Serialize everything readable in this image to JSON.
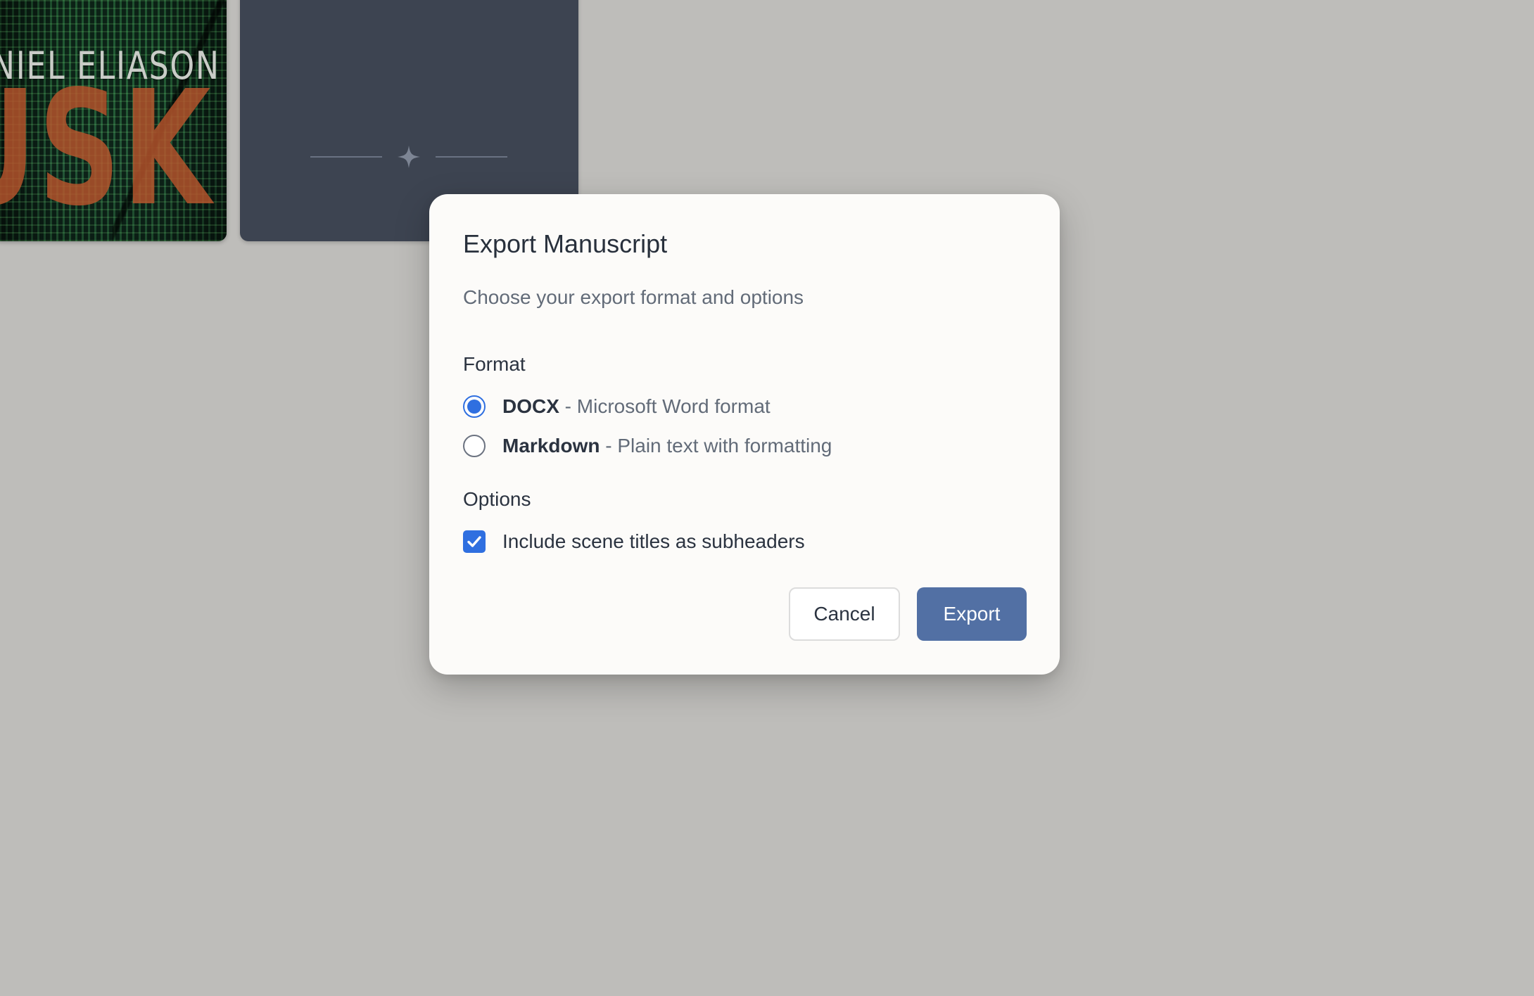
{
  "background": {
    "book_cover": {
      "author_text": "ANIEL  ELIASON",
      "title_text": "USK"
    },
    "slate_card": {
      "ornament_icon": "four-point-star-divider"
    }
  },
  "dialog": {
    "title": "Export Manuscript",
    "subtitle": "Choose your export format and options",
    "format_section": {
      "label": "Format",
      "options": [
        {
          "name": "DOCX",
          "separator": " - ",
          "description": "Microsoft Word format",
          "selected": true
        },
        {
          "name": "Markdown",
          "separator": " - ",
          "description": "Plain text with formatting",
          "selected": false
        }
      ]
    },
    "options_section": {
      "label": "Options",
      "checkboxes": [
        {
          "label": "Include scene titles as subheaders",
          "checked": true
        }
      ]
    },
    "buttons": {
      "cancel": "Cancel",
      "export": "Export"
    }
  },
  "colors": {
    "backdrop": "#bebdba",
    "accent": "#2f6fe0",
    "primary_button": "#5270a4",
    "slate_card": "#3d4451"
  }
}
